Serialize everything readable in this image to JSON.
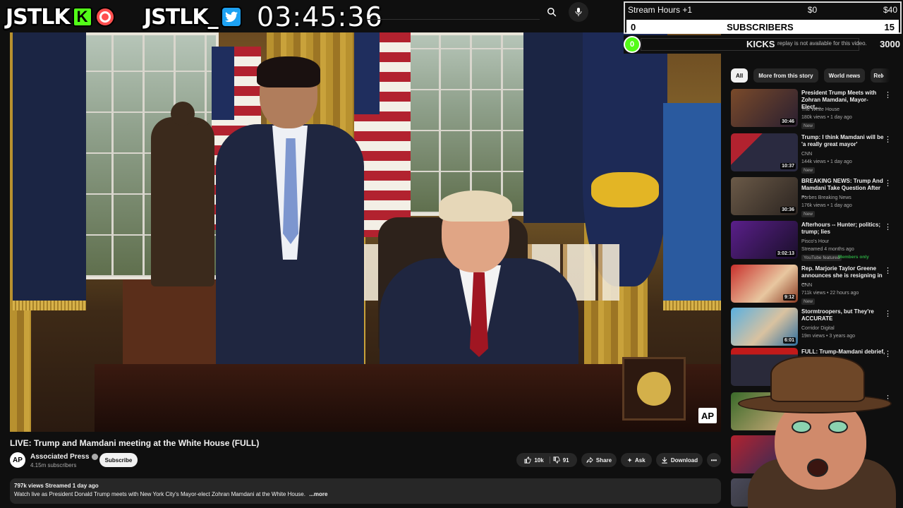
{
  "overlay": {
    "brand1": "JSTLK",
    "brand2": "JSTLK_",
    "kick_letter": "K",
    "timer": "03:45:36",
    "goal": {
      "label": "Stream Hours +1",
      "current": "$0",
      "target": "$40",
      "subs_current": "0",
      "subs_label": "SUBSCRIBERS",
      "subs_target": "15"
    },
    "kicks": {
      "count": "0",
      "label": "KICKS",
      "target": "3000",
      "replay_note": "replay is not available for this video."
    }
  },
  "video": {
    "title": "LIVE: Trump and Mamdani meeting at the White House (FULL)",
    "watermark": "AP",
    "channel": {
      "avatar": "AP",
      "name": "Associated Press",
      "subs": "4.15m subscribers",
      "subscribe_label": "Subscribe"
    },
    "actions": {
      "likes": "10k",
      "dislikes": "91",
      "share": "Share",
      "ask": "Ask",
      "download": "Download"
    },
    "description": {
      "meta": "797k views  Streamed 1 day ago",
      "text": "Watch live as President Donald Trump meets with New York City's Mayor-elect Zohran Mamdani at the White House.",
      "more": "...more"
    }
  },
  "chips": [
    "All",
    "More from this story",
    "World news",
    "Rel"
  ],
  "recommendations": [
    {
      "title": "President Trump Meets with Zohran Mamdani, Mayor-Elect,...",
      "channel": "The White House",
      "views": "180k views • 1 day ago",
      "tag": "New",
      "duration": "30:46",
      "color": "#5b3b2a"
    },
    {
      "title": "Trump: I think Mamdani will be 'a really great mayor'",
      "channel": "CNN",
      "views": "144k views • 1 day ago",
      "tag": "New",
      "duration": "10:37",
      "color": "#3a3340"
    },
    {
      "title": "BREAKING NEWS: Trump And Mamdani Take Question After ...",
      "channel": "Forbes Breaking News",
      "views": "176k views • 1 day ago",
      "tag": "New",
      "duration": "30:36",
      "color": "#4a3a2e"
    },
    {
      "title": "Afterhours -- Hunter; politics; trump; lies",
      "channel": "Pisco's Hour",
      "views": "Streamed 4 months ago",
      "tag": "YouTube featured",
      "members": "Members only",
      "duration": "3:02:13",
      "color": "#3a1f5a"
    },
    {
      "title": "Rep. Marjorie Taylor Greene announces she is resigning in ...",
      "channel": "CNN",
      "views": "711k views • 22 hours ago",
      "tag": "New",
      "duration": "9:12",
      "color": "#6b2a22"
    },
    {
      "title": "Stormtroopers, but They're ACCURATE",
      "channel": "Corridor Digital",
      "views": "19m views • 3 years ago",
      "tag": "",
      "duration": "6:01",
      "color": "#2f6f9f"
    },
    {
      "title": "FULL: Trump-Mamdani debrief,",
      "channel": "",
      "views": "",
      "tag": "",
      "duration": "",
      "color": "#2a2a3a"
    }
  ]
}
